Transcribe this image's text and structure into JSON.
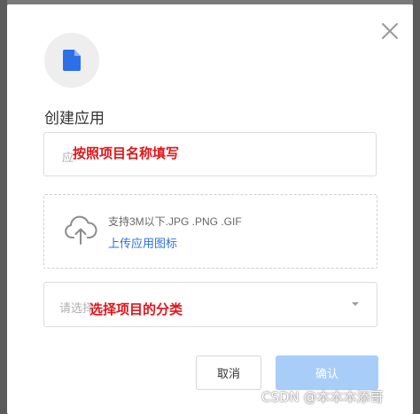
{
  "dialog": {
    "title": "创建应用",
    "name_input": {
      "placeholder": "应"
    },
    "upload": {
      "hint": "支持3M以下.JPG .PNG .GIF",
      "link_label": "上传应用图标"
    },
    "category_select": {
      "placeholder": "请选择"
    },
    "buttons": {
      "cancel": "取消",
      "confirm": "确认"
    }
  },
  "annotations": {
    "name_note": "按照项目名称填写",
    "category_note": "选择项目的分类"
  },
  "watermark": "CSDN @本本本添哥",
  "icons": {
    "close": "close-icon",
    "app": "file-icon",
    "upload": "cloud-upload-icon",
    "dropdown": "chevron-down-icon"
  },
  "colors": {
    "accent": "#2f6fdf",
    "confirm_disabled": "#a9cdf9",
    "annotation": "#e0151b",
    "file_icon": "#2d6fe6"
  }
}
